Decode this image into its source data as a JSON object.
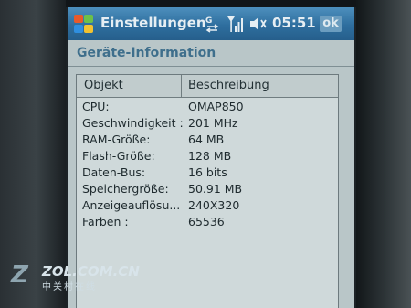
{
  "titlebar": {
    "app_title": "Einstellungen",
    "clock": "05:51",
    "ok_label": "ok",
    "icons": [
      "windows-start-icon",
      "connectivity-icon",
      "signal-strength-icon",
      "volume-icon"
    ]
  },
  "page": {
    "title": "Geräte-Information"
  },
  "table": {
    "columns": [
      "Objekt",
      "Beschreibung"
    ],
    "rows": [
      [
        "CPU:",
        "OMAP850"
      ],
      [
        "Geschwindigkeit :",
        "201 MHz"
      ],
      [
        "RAM-Größe:",
        "64 MB"
      ],
      [
        "Flash-Größe:",
        "128 MB"
      ],
      [
        "Daten-Bus:",
        "16 bits"
      ],
      [
        "Speichergröße:",
        "50.91 MB"
      ],
      [
        "Anzeigeauflösu...",
        "240X320"
      ],
      [
        "Farben :",
        "65536"
      ]
    ]
  },
  "watermark": {
    "logo": "Z",
    "domain": "ZOL.COM.CN",
    "sub": "中关村在线"
  },
  "colors": {
    "titlebar": "#2e6e9e",
    "screen_bg": "#b9c6c8",
    "page_title": "#3f6f8c"
  }
}
